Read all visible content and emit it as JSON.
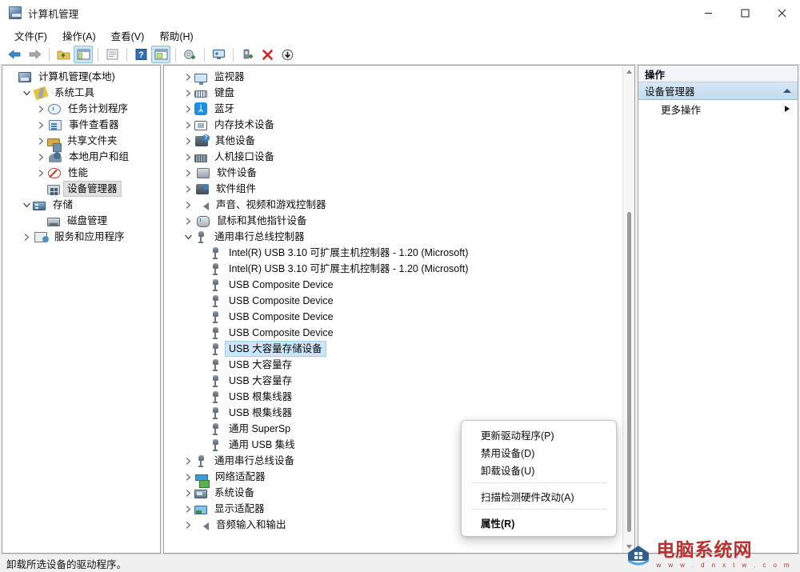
{
  "window": {
    "title": "计算机管理",
    "title_icon": "mmc-console-icon",
    "controls": {
      "minimize": "minimize-icon",
      "maximize": "maximize-icon",
      "close": "close-icon"
    }
  },
  "menubar": [
    {
      "label": "文件(F)",
      "name": "menu-file"
    },
    {
      "label": "操作(A)",
      "name": "menu-action"
    },
    {
      "label": "查看(V)",
      "name": "menu-view"
    },
    {
      "label": "帮助(H)",
      "name": "menu-help"
    }
  ],
  "toolbar": [
    {
      "name": "back-button",
      "icon": "arrow-left-icon",
      "active": false
    },
    {
      "name": "forward-button",
      "icon": "arrow-right-icon",
      "active": false
    },
    {
      "sep": true
    },
    {
      "name": "up-one-level-button",
      "icon": "folder-up-icon",
      "active": false
    },
    {
      "name": "show-hide-console-tree-button",
      "icon": "console-tree-icon",
      "active": true
    },
    {
      "sep": true
    },
    {
      "name": "properties-button",
      "icon": "properties-icon",
      "active": false
    },
    {
      "sep": true
    },
    {
      "name": "help-button",
      "icon": "help-question-icon",
      "active": false
    },
    {
      "name": "show-hide-action-pane-button",
      "icon": "action-pane-icon",
      "active": true
    },
    {
      "sep": true
    },
    {
      "name": "update-driver-button",
      "icon": "update-driver-icon",
      "active": false
    },
    {
      "sep": true
    },
    {
      "name": "scan-hardware-changes-button",
      "icon": "scan-monitor-icon",
      "active": false
    },
    {
      "sep": true
    },
    {
      "name": "enable-device-button",
      "icon": "enable-device-icon",
      "active": false
    },
    {
      "name": "uninstall-device-button",
      "icon": "red-x-icon",
      "active": false
    },
    {
      "name": "disable-device-button",
      "icon": "down-arrow-circle-icon",
      "active": false
    }
  ],
  "sidebar": {
    "items": [
      {
        "label": "计算机管理(本地)",
        "indent": 0,
        "chev": "none",
        "icon": "mmc",
        "name": "sidebar-item-computer-management-local"
      },
      {
        "label": "系统工具",
        "indent": 1,
        "chev": "down",
        "icon": "tools",
        "name": "sidebar-item-system-tools"
      },
      {
        "label": "任务计划程序",
        "indent": 2,
        "chev": "right",
        "icon": "clock",
        "name": "sidebar-item-task-scheduler"
      },
      {
        "label": "事件查看器",
        "indent": 2,
        "chev": "right",
        "icon": "event",
        "name": "sidebar-item-event-viewer"
      },
      {
        "label": "共享文件夹",
        "indent": 2,
        "chev": "right",
        "icon": "folder",
        "name": "sidebar-item-shared-folders"
      },
      {
        "label": "本地用户和组",
        "indent": 2,
        "chev": "right",
        "icon": "users",
        "name": "sidebar-item-local-users-groups"
      },
      {
        "label": "性能",
        "indent": 2,
        "chev": "right",
        "icon": "perf",
        "name": "sidebar-item-performance"
      },
      {
        "label": "设备管理器",
        "indent": 2,
        "chev": "none",
        "icon": "devmgr",
        "name": "sidebar-item-device-manager",
        "selected": true
      },
      {
        "label": "存储",
        "indent": 1,
        "chev": "down",
        "icon": "storage",
        "name": "sidebar-item-storage"
      },
      {
        "label": "磁盘管理",
        "indent": 2,
        "chev": "none",
        "icon": "disk",
        "name": "sidebar-item-disk-management"
      },
      {
        "label": "服务和应用程序",
        "indent": 1,
        "chev": "right",
        "icon": "svc",
        "name": "sidebar-item-services-applications"
      }
    ]
  },
  "device_tree": {
    "items": [
      {
        "label": "监视器",
        "indent": 1,
        "chev": "right",
        "icon": "monitor",
        "name": "device-node-monitors"
      },
      {
        "label": "键盘",
        "indent": 1,
        "chev": "right",
        "icon": "keyboard",
        "name": "device-node-keyboards"
      },
      {
        "label": "蓝牙",
        "indent": 1,
        "chev": "right",
        "icon": "bt",
        "name": "device-node-bluetooth"
      },
      {
        "label": "内存技术设备",
        "indent": 1,
        "chev": "right",
        "icon": "mem",
        "name": "device-node-memory-technology"
      },
      {
        "label": "其他设备",
        "indent": 1,
        "chev": "right",
        "icon": "other",
        "name": "device-node-other-devices"
      },
      {
        "label": "人机接口设备",
        "indent": 1,
        "chev": "right",
        "icon": "hid",
        "name": "device-node-hid"
      },
      {
        "label": "软件设备",
        "indent": 1,
        "chev": "right",
        "icon": "softdev",
        "name": "device-node-software-devices"
      },
      {
        "label": "软件组件",
        "indent": 1,
        "chev": "right",
        "icon": "softcomp",
        "name": "device-node-software-components"
      },
      {
        "label": "声音、视频和游戏控制器",
        "indent": 1,
        "chev": "right",
        "icon": "speaker",
        "name": "device-node-sound-video-game"
      },
      {
        "label": "鼠标和其他指针设备",
        "indent": 1,
        "chev": "right",
        "icon": "mouse",
        "name": "device-node-mice-pointing"
      },
      {
        "label": "通用串行总线控制器",
        "indent": 1,
        "chev": "down",
        "icon": "usb",
        "name": "device-node-usb-controllers"
      },
      {
        "label": "Intel(R) USB 3.10 可扩展主机控制器 - 1.20 (Microsoft)",
        "indent": 2,
        "chev": "none",
        "icon": "usb",
        "name": "device-leaf-intel-usb-xhci-1"
      },
      {
        "label": "Intel(R) USB 3.10 可扩展主机控制器 - 1.20 (Microsoft)",
        "indent": 2,
        "chev": "none",
        "icon": "usb",
        "name": "device-leaf-intel-usb-xhci-2"
      },
      {
        "label": "USB Composite Device",
        "indent": 2,
        "chev": "none",
        "icon": "usb",
        "name": "device-leaf-usb-composite-1"
      },
      {
        "label": "USB Composite Device",
        "indent": 2,
        "chev": "none",
        "icon": "usb",
        "name": "device-leaf-usb-composite-2"
      },
      {
        "label": "USB Composite Device",
        "indent": 2,
        "chev": "none",
        "icon": "usb",
        "name": "device-leaf-usb-composite-3"
      },
      {
        "label": "USB Composite Device",
        "indent": 2,
        "chev": "none",
        "icon": "usb",
        "name": "device-leaf-usb-composite-4"
      },
      {
        "label": "USB 大容量存储设备",
        "indent": 2,
        "chev": "none",
        "icon": "usb",
        "name": "device-leaf-usb-mass-storage-1",
        "selected": true
      },
      {
        "label": "USB 大容量存",
        "indent": 2,
        "chev": "none",
        "icon": "usb",
        "name": "device-leaf-usb-mass-storage-2"
      },
      {
        "label": "USB 大容量存",
        "indent": 2,
        "chev": "none",
        "icon": "usb",
        "name": "device-leaf-usb-mass-storage-3"
      },
      {
        "label": "USB 根集线器",
        "indent": 2,
        "chev": "none",
        "icon": "usb",
        "name": "device-leaf-usb-root-hub-1"
      },
      {
        "label": "USB 根集线器",
        "indent": 2,
        "chev": "none",
        "icon": "usb",
        "name": "device-leaf-usb-root-hub-2"
      },
      {
        "label": "通用 SuperSp",
        "indent": 2,
        "chev": "none",
        "icon": "usb",
        "name": "device-leaf-generic-superspeed-hub"
      },
      {
        "label": "通用 USB 集线",
        "indent": 2,
        "chev": "none",
        "icon": "usb",
        "name": "device-leaf-generic-usb-hub"
      },
      {
        "label": "通用串行总线设备",
        "indent": 1,
        "chev": "right",
        "icon": "usb",
        "name": "device-node-usb-devices"
      },
      {
        "label": "网络适配器",
        "indent": 1,
        "chev": "right",
        "icon": "net",
        "name": "device-node-network-adapters"
      },
      {
        "label": "系统设备",
        "indent": 1,
        "chev": "right",
        "icon": "sysdev",
        "name": "device-node-system-devices"
      },
      {
        "label": "显示适配器",
        "indent": 1,
        "chev": "right",
        "icon": "display",
        "name": "device-node-display-adapters"
      },
      {
        "label": "音频输入和输出",
        "indent": 1,
        "chev": "right",
        "icon": "audio",
        "name": "device-node-audio-inputs-outputs"
      }
    ]
  },
  "context_menu": {
    "items": [
      {
        "label": "更新驱动程序(P)",
        "name": "ctx-update-driver",
        "bold": false,
        "sep_after": false
      },
      {
        "label": "禁用设备(D)",
        "name": "ctx-disable-device",
        "bold": false,
        "sep_after": false
      },
      {
        "label": "卸载设备(U)",
        "name": "ctx-uninstall-device",
        "bold": false,
        "sep_after": true
      },
      {
        "label": "扫描检测硬件改动(A)",
        "name": "ctx-scan-hardware-changes",
        "bold": false,
        "sep_after": true
      },
      {
        "label": "属性(R)",
        "name": "ctx-properties",
        "bold": true,
        "sep_after": false
      }
    ]
  },
  "actions_pane": {
    "header": "操作",
    "group": "设备管理器",
    "group_collapse_icon": "chevron-up-icon",
    "items": [
      {
        "label": "更多操作",
        "name": "actions-item-more-actions",
        "submenu_icon": "chevron-right-icon"
      }
    ]
  },
  "statusbar": {
    "text": "卸载所选设备的驱动程序。"
  },
  "watermark": {
    "title": "电脑系统网",
    "url": "w w w . d n x t w . c o m"
  },
  "colors": {
    "selection_blue": "#cce4f7",
    "selection_gray": "#e0e0e0",
    "actions_group_bg": "#c9dcef",
    "watermark_red": "#b8312f",
    "accent_toolbar_active": "#cde6f7"
  }
}
